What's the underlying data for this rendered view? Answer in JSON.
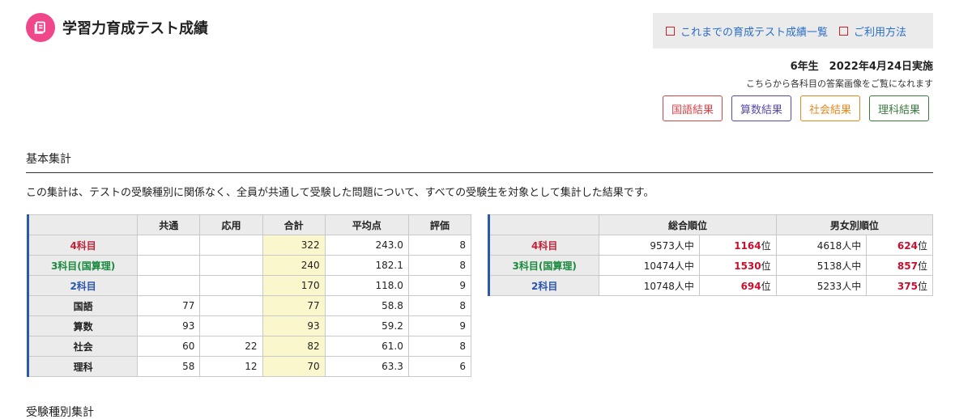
{
  "app": {
    "title": "学習力育成テスト成績",
    "logo_icon": "book-icon",
    "logo_color": "#f0468a"
  },
  "top_links": [
    {
      "label": "これまでの育成テスト成績一覧",
      "icon": "square-icon"
    },
    {
      "label": "ご利用方法",
      "icon": "square-icon"
    }
  ],
  "exam_info": "6年生　2022年4月24日実施",
  "answer_note": "こちらから各科目の答案画像をご覧になれます",
  "subject_buttons": [
    {
      "label": "国語結果",
      "color": "#d9434a"
    },
    {
      "label": "算数結果",
      "color": "#5a4aa8"
    },
    {
      "label": "社会結果",
      "color": "#e8871e"
    },
    {
      "label": "理科結果",
      "color": "#3a7a3e"
    }
  ],
  "basic_section": {
    "title": "基本集計",
    "description": "この集計は、テストの受験種別に関係なく、全員が共通して受験した問題について、すべての受験生を対象として集計した結果です。"
  },
  "score_table": {
    "headers": [
      "",
      "共通",
      "応用",
      "合計",
      "平均点",
      "評価"
    ],
    "rows": [
      {
        "name": "4科目",
        "kyotsu": "",
        "oyo": "",
        "total": "322",
        "avg": "243.0",
        "grade": "8"
      },
      {
        "name": "3科目(国算理)",
        "kyotsu": "",
        "oyo": "",
        "total": "240",
        "avg": "182.1",
        "grade": "8"
      },
      {
        "name": "2科目",
        "kyotsu": "",
        "oyo": "",
        "total": "170",
        "avg": "118.0",
        "grade": "9"
      },
      {
        "name": "国語",
        "kyotsu": "77",
        "oyo": "",
        "total": "77",
        "avg": "58.8",
        "grade": "8"
      },
      {
        "name": "算数",
        "kyotsu": "93",
        "oyo": "",
        "total": "93",
        "avg": "59.2",
        "grade": "9"
      },
      {
        "name": "社会",
        "kyotsu": "60",
        "oyo": "22",
        "total": "82",
        "avg": "61.0",
        "grade": "8"
      },
      {
        "name": "理科",
        "kyotsu": "58",
        "oyo": "12",
        "total": "70",
        "avg": "63.3",
        "grade": "6"
      }
    ]
  },
  "rank_table": {
    "headers": [
      "",
      "総合順位",
      "男女別順位"
    ],
    "rows": [
      {
        "name": "4科目",
        "overall_total": "9573人中",
        "overall_rank": "1164",
        "gender_total": "4618人中",
        "gender_rank": "624"
      },
      {
        "name": "3科目(国算理)",
        "overall_total": "10474人中",
        "overall_rank": "1530",
        "gender_total": "5138人中",
        "gender_rank": "857"
      },
      {
        "name": "2科目",
        "overall_total": "10748人中",
        "overall_rank": "694",
        "gender_total": "5233人中",
        "gender_rank": "375"
      }
    ],
    "rank_suffix": "位"
  },
  "exam_type_section": {
    "title": "受験種別集計"
  }
}
